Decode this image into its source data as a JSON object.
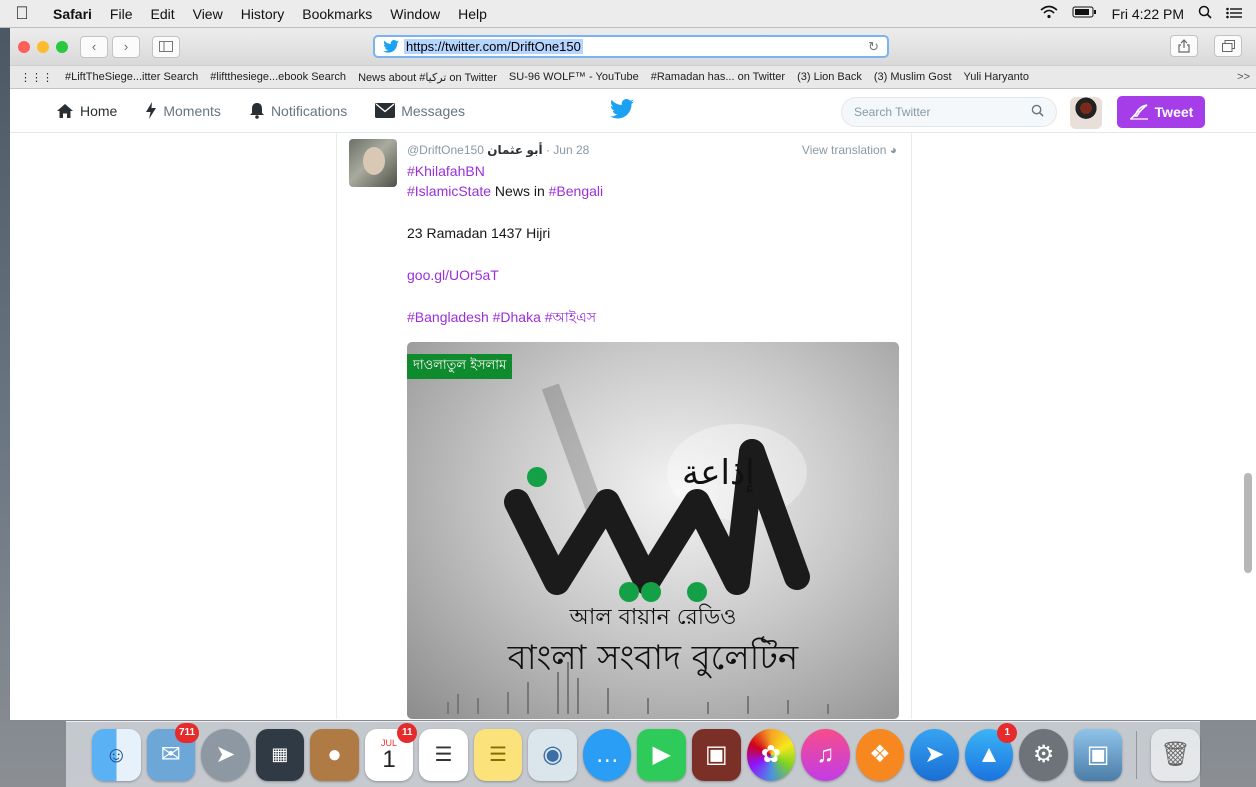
{
  "menubar": {
    "app": "Safari",
    "items": [
      "File",
      "Edit",
      "View",
      "History",
      "Bookmarks",
      "Window",
      "Help"
    ],
    "clock": "Fri 4:22 PM"
  },
  "browser": {
    "url": "https://twitter.com/DriftOne150",
    "bookmarks": [
      "#LiftTheSiege...itter Search",
      "#liftthesiege...ebook Search",
      "News about #تركيا on Twitter",
      "SU-96 WOLF™ - YouTube",
      "#Ramadan has... on Twitter",
      "(3) Lion Back",
      "(3) Muslim Gost",
      "Yuli Haryanto"
    ],
    "more": ">>"
  },
  "twitter_nav": {
    "home": "Home",
    "moments": "Moments",
    "notifications": "Notifications",
    "messages": "Messages",
    "search_placeholder": "Search Twitter",
    "tweet_button": "Tweet"
  },
  "tweet": {
    "name": "أبو عثمان",
    "handle": "@DriftOne150",
    "date": "· Jun 28",
    "view_translation": "View translation",
    "line1": "#KhilafahBN",
    "line2_tag1": "#IslamicState",
    "line2_text": " News in ",
    "line2_tag2": "#Bengali",
    "line3": "23 Ramadan 1437 Hijri",
    "link": "goo.gl/UOr5aT",
    "tags_line": "#Bangladesh #Dhaka #আইএস",
    "media": {
      "badge": "দাওলাতুল ইসলাম",
      "arabic_title": "إذاعة",
      "subtitle1": "আল বায়ান রেডিও",
      "subtitle2": "বাংলা সংবাদ বুলেটিন"
    }
  },
  "dock": {
    "mail_badge": "711",
    "calendar_badge": "11",
    "calendar_month": "JUL",
    "calendar_day": "1",
    "appstore_badge": "1"
  },
  "colors": {
    "accent": "#a53de8",
    "hashtag": "#9b2fd9",
    "twitter_blue": "#1da1f2"
  }
}
